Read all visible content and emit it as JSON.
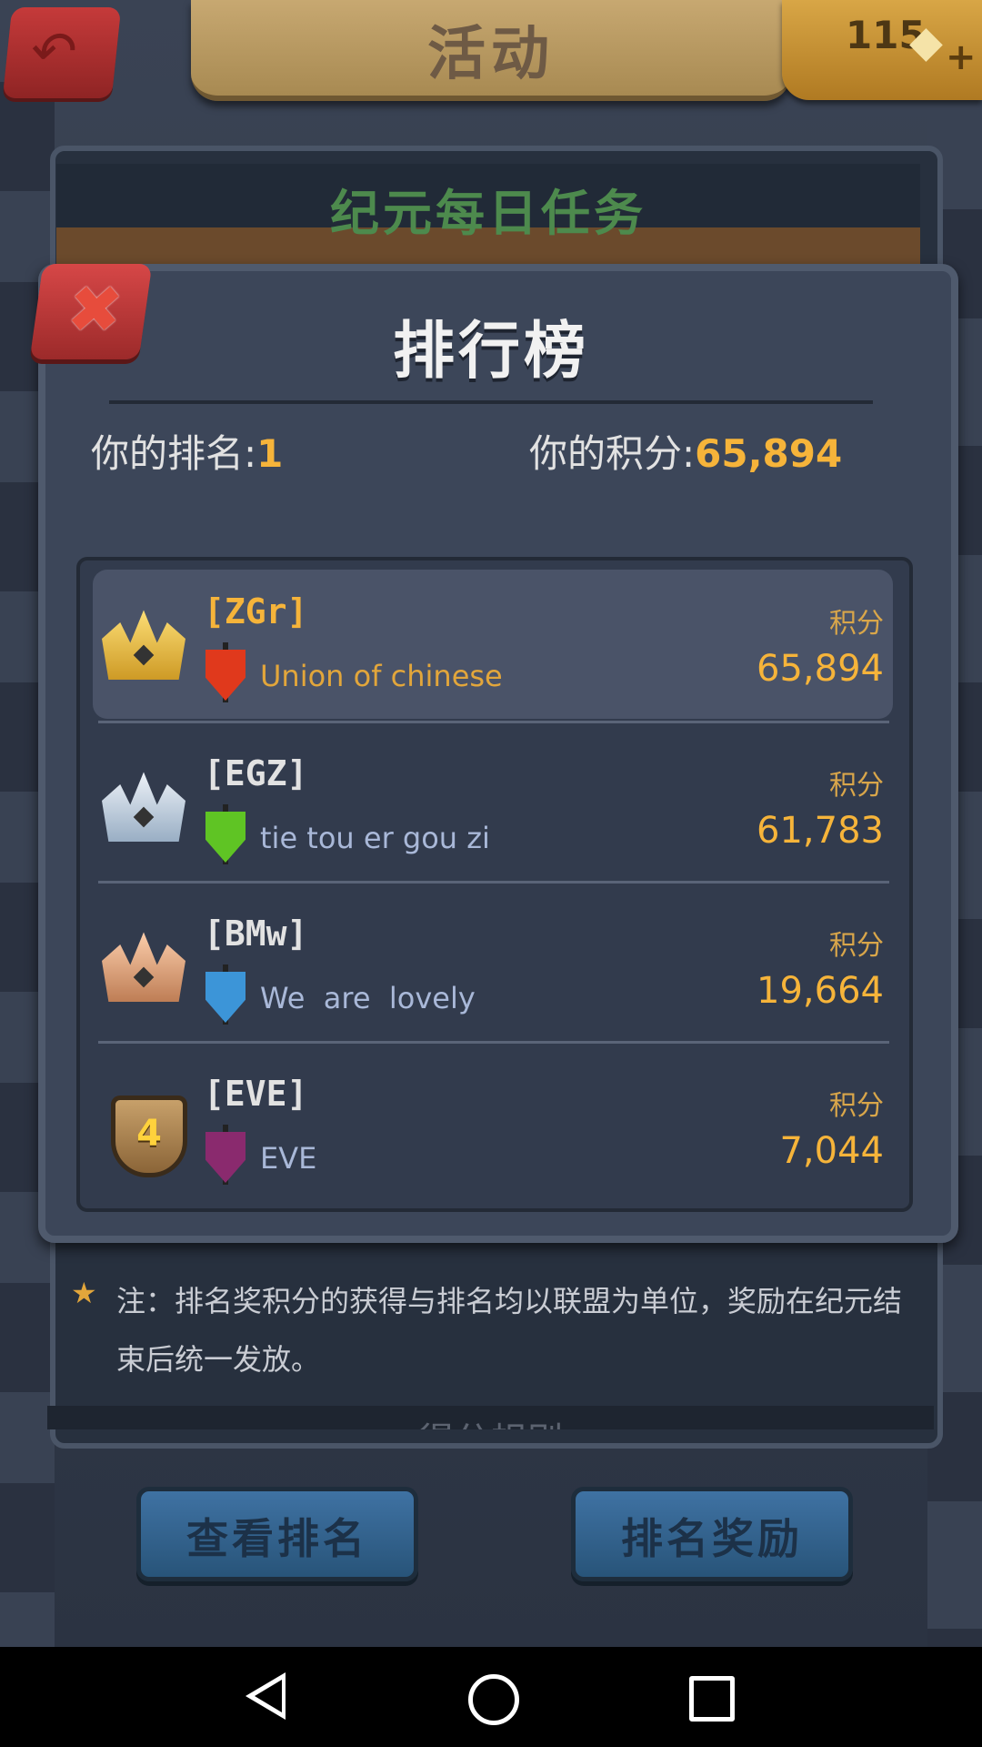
{
  "header": {
    "title": "活动",
    "gems": "115",
    "back_icon": "back-arrow-icon",
    "gem_icon": "diamond-icon"
  },
  "event_banner": {
    "title": "纪元每日任务"
  },
  "modal": {
    "title": "排行榜",
    "close_icon": "close-x-icon",
    "my_rank_label": "你的排名:",
    "my_rank_value": "1",
    "my_score_label": "你的积分:",
    "my_score_value": "65,894"
  },
  "leaderboard": [
    {
      "badge": "gold-crown-icon",
      "tag": "[ZGr]",
      "flag_color": "#e0391c",
      "alliance": "Union of chinese",
      "points_label": "积分",
      "points": "65,894"
    },
    {
      "badge": "silver-crown-icon",
      "tag": "[EGZ]",
      "flag_color": "#5fc424",
      "alliance": "tie tou er gou zi",
      "points_label": "积分",
      "points": "61,783"
    },
    {
      "badge": "bronze-crown-icon",
      "tag": "[BMw]",
      "flag_color": "#3c95d8",
      "alliance": "We  are  lovely",
      "points_label": "积分",
      "points": "19,664"
    },
    {
      "badge": "rank-4-shield-icon",
      "rank_number": "4",
      "tag": "[EVE]",
      "flag_color": "#8a2a6e",
      "alliance": "EVE",
      "points_label": "积分",
      "points": "7,044"
    }
  ],
  "note": {
    "icon": "star-icon",
    "text": "注：排名奖积分的获得与排名均以联盟为单位，奖励在纪元结束后统一发放。"
  },
  "rules_header": "得分规则",
  "buttons": {
    "view_ranking": "查看排名",
    "ranking_rewards": "排名奖励"
  },
  "colors": {
    "accent_gold": "#f6b43a",
    "highlight_tag": "#f6b43a",
    "normal_tag": "#e2e2e2",
    "highlight_alliance": "#e2a63b",
    "normal_alliance": "#a9b8d8"
  }
}
